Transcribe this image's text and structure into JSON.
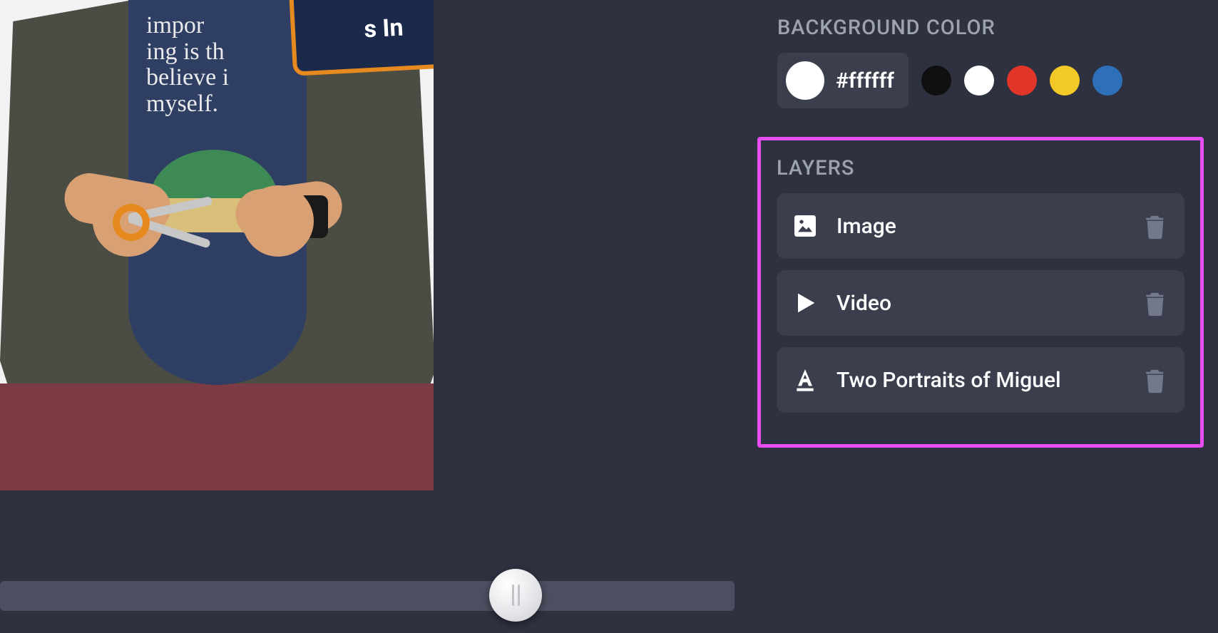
{
  "preview": {
    "banner_text_fragment": "s In",
    "tshirt_lines": [
      "impor",
      "ing is th",
      "believe i",
      "myself."
    ]
  },
  "panel": {
    "bgcolor": {
      "label": "BACKGROUND COLOR",
      "value_hex": "#ffffff",
      "swatch_color": "#ffffff",
      "presets": [
        {
          "name": "black",
          "hex": "#101010"
        },
        {
          "name": "white",
          "hex": "#ffffff"
        },
        {
          "name": "red",
          "hex": "#e1352a"
        },
        {
          "name": "yellow",
          "hex": "#f3c928"
        },
        {
          "name": "blue",
          "hex": "#2d6fb9"
        }
      ]
    },
    "layers": {
      "label": "LAYERS",
      "items": [
        {
          "kind": "image",
          "label": "Image"
        },
        {
          "kind": "video",
          "label": "Video"
        },
        {
          "kind": "text",
          "label": "Two Portraits of Miguel"
        }
      ]
    }
  },
  "colors": {
    "panel_bg": "#2d3140",
    "card_bg": "#3a3e4d",
    "label_muted": "#9da2af",
    "highlight_border": "#e84df2",
    "trash_icon": "#73788a"
  }
}
